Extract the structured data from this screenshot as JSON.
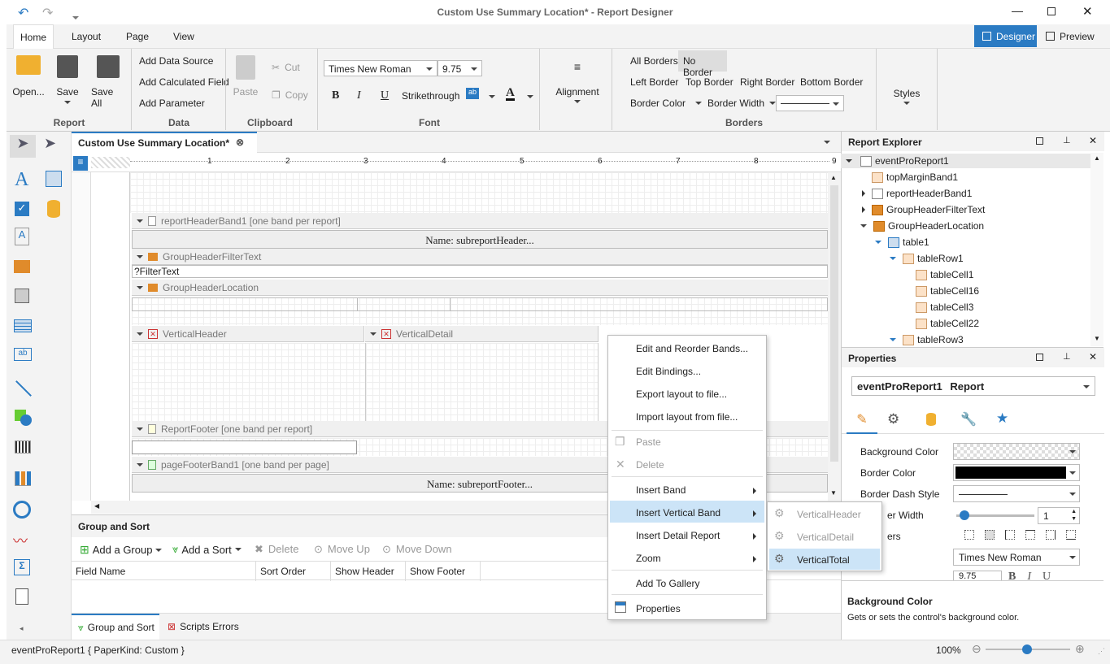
{
  "title": "Custom Use Summary Location* - Report Designer",
  "tabs": [
    "Home",
    "Layout",
    "Page",
    "View"
  ],
  "views": {
    "designer": "Designer",
    "preview": "Preview"
  },
  "ribbon": {
    "open": "Open...",
    "save": "Save",
    "save_all": "Save All",
    "group_report": "Report",
    "add_data_source": "Add Data Source",
    "add_calc_field": "Add Calculated Field",
    "add_parameter": "Add Parameter",
    "group_data": "Data",
    "paste": "Paste",
    "cut": "Cut",
    "copy": "Copy",
    "group_clipboard": "Clipboard",
    "font_name": "Times New Roman",
    "font_size": "9.75",
    "bold": "B",
    "italic": "I",
    "underline": "U",
    "strikethrough": "Strikethrough",
    "group_font": "Font",
    "alignment": "Alignment",
    "all_borders": "All Borders",
    "no_border": "No Border",
    "left_border": "Left Border",
    "top_border": "Top Border",
    "right_border": "Right Border",
    "bottom_border": "Bottom Border",
    "border_color": "Border Color",
    "border_width": "Border Width",
    "group_borders": "Borders",
    "styles": "Styles"
  },
  "doc_tab": "Custom Use Summary Location*",
  "ruler": [
    "1",
    "2",
    "3",
    "4",
    "5",
    "6",
    "7",
    "8",
    "9"
  ],
  "bands": {
    "report_header": "reportHeaderBand1 [one band per report]",
    "name_header": "Name: subreportHeader...",
    "filter": "GroupHeaderFilterText",
    "filter_text": "?FilterText",
    "location": "GroupHeaderLocation",
    "vheader": "VerticalHeader",
    "vdetail": "VerticalDetail",
    "report_footer": "ReportFooter [one band per report]",
    "page_footer": "pageFooterBand1 [one band per page]",
    "name_footer": "Name: subreportFooter..."
  },
  "group_sort": {
    "title": "Group and Sort",
    "add_group": "Add a Group",
    "add_sort": "Add a Sort",
    "delete": "Delete",
    "move_up": "Move Up",
    "move_down": "Move Down",
    "columns": [
      "Field Name",
      "Sort Order",
      "Show Header",
      "Show Footer"
    ]
  },
  "bottom_tabs": [
    "Group and Sort",
    "Scripts Errors"
  ],
  "status": {
    "text": "eventProReport1 { PaperKind: Custom }",
    "zoom": "100%"
  },
  "context_menu": [
    "Edit and Reorder Bands...",
    "Edit Bindings...",
    "Export layout to file...",
    "Import layout from file...",
    "Paste",
    "Delete",
    "Insert Band",
    "Insert Vertical Band",
    "Insert Detail Report",
    "Zoom",
    "Add To Gallery",
    "Properties"
  ],
  "submenu": [
    "VerticalHeader",
    "VerticalDetail",
    "VerticalTotal"
  ],
  "explorer": {
    "title": "Report Explorer",
    "items": [
      "eventProReport1",
      "topMarginBand1",
      "reportHeaderBand1",
      "GroupHeaderFilterText",
      "GroupHeaderLocation",
      "table1",
      "tableRow1",
      "tableCell1",
      "tableCell16",
      "tableCell3",
      "tableCell22",
      "tableRow3"
    ]
  },
  "properties": {
    "title": "Properties",
    "selector": "eventProReport1",
    "selector_type": "Report",
    "rows": [
      "Background Color",
      "Border Color",
      "Border Dash Style",
      "Border Width",
      "Borders"
    ],
    "rows_shown": [
      "Background Color",
      "Border Color",
      "Border Dash Style",
      "er Width",
      "ers"
    ],
    "border_width_value": "1",
    "font_value": "Times New Roman",
    "font_size": "9.75",
    "desc_title": "Background Color",
    "desc_text": "Gets or sets the control's background color."
  },
  "colors": {
    "accent": "#2b7bc3",
    "selected": "#cde4f7",
    "menu_hl": "#cce4f7"
  }
}
